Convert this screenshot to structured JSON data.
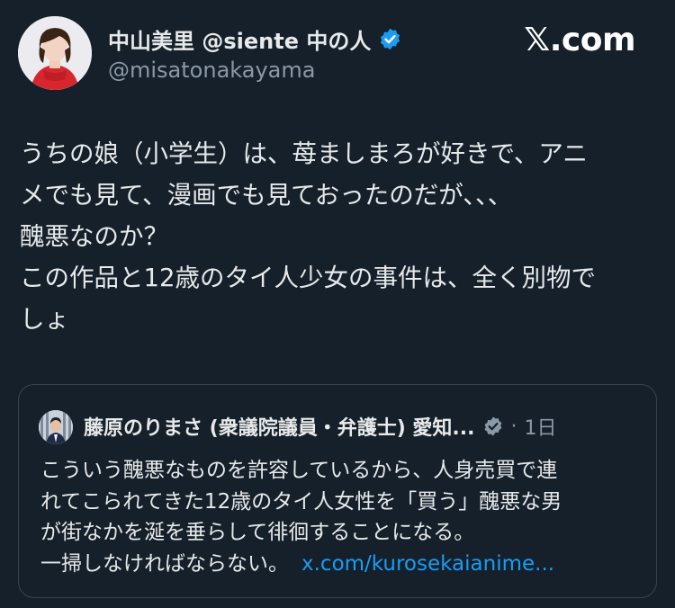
{
  "author": {
    "name": "中山美里 @siente 中の人",
    "handle": "@misatonakayama",
    "verified_color": "#1d9bf0"
  },
  "brand": "𝕏.com",
  "tweet": {
    "lines": [
      "うちの娘（小学生）は、苺ましまろが好きで、アニ",
      "メでも見て、漫画でも見ておったのだが、、、",
      "醜悪なのか？",
      "この作品と12歳のタイ人少女の事件は、全く別物で",
      "しょ"
    ]
  },
  "quote": {
    "name": "藤原のりまさ (衆議院議員・弁護士) 愛知...",
    "verified_color": "#8b98a5",
    "dot": "·",
    "time": "1日",
    "lines": [
      "こういう醜悪なものを許容しているから、人身売買で連",
      "れてこられてきた12歳のタイ人女性を「買う」醜悪な男",
      "が街なかを涎を垂らして徘徊することになる。",
      "一掃しなければならない。"
    ],
    "link": "x.com/kurosekaianime..."
  }
}
